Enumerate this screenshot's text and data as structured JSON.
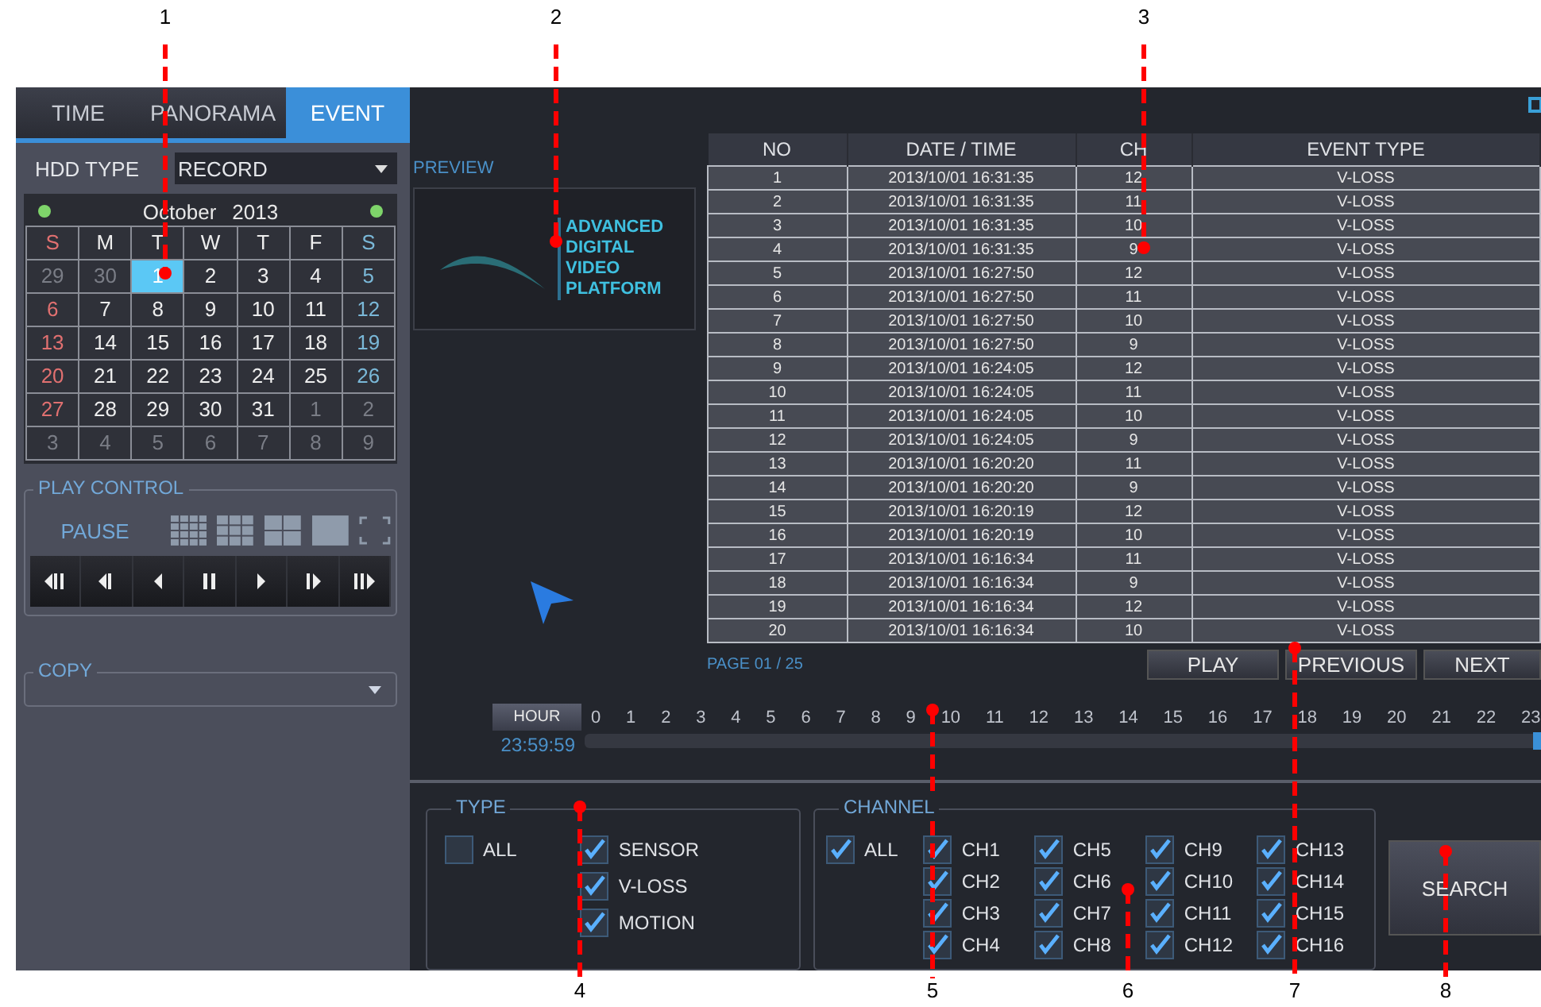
{
  "callouts": [
    {
      "label": "1"
    },
    {
      "label": "2"
    },
    {
      "label": "3"
    },
    {
      "label": "4"
    },
    {
      "label": "5"
    },
    {
      "label": "6"
    },
    {
      "label": "7"
    },
    {
      "label": "8"
    }
  ],
  "tabs": [
    {
      "label": "TIME",
      "selected": false
    },
    {
      "label": "PANORAMA",
      "selected": false
    },
    {
      "label": "EVENT",
      "selected": true
    }
  ],
  "hdd_type": {
    "label": "HDD TYPE",
    "value": "RECORD"
  },
  "calendar": {
    "month": "October",
    "year": "2013",
    "weekdays": [
      "S",
      "M",
      "T",
      "W",
      "T",
      "F",
      "S"
    ],
    "weeks": [
      [
        {
          "day": "29",
          "muted": true,
          "selected": false
        },
        {
          "day": "30",
          "muted": true,
          "selected": false
        },
        {
          "day": "1",
          "muted": false,
          "selected": true
        },
        {
          "day": "2",
          "muted": false,
          "selected": false
        },
        {
          "day": "3",
          "muted": false,
          "selected": false
        },
        {
          "day": "4",
          "muted": false,
          "selected": false
        },
        {
          "day": "5",
          "muted": false,
          "selected": false
        }
      ],
      [
        {
          "day": "6",
          "muted": false,
          "selected": false
        },
        {
          "day": "7",
          "muted": false,
          "selected": false
        },
        {
          "day": "8",
          "muted": false,
          "selected": false
        },
        {
          "day": "9",
          "muted": false,
          "selected": false
        },
        {
          "day": "10",
          "muted": false,
          "selected": false
        },
        {
          "day": "11",
          "muted": false,
          "selected": false
        },
        {
          "day": "12",
          "muted": false,
          "selected": false
        }
      ],
      [
        {
          "day": "13",
          "muted": false,
          "selected": false
        },
        {
          "day": "14",
          "muted": false,
          "selected": false
        },
        {
          "day": "15",
          "muted": false,
          "selected": false
        },
        {
          "day": "16",
          "muted": false,
          "selected": false
        },
        {
          "day": "17",
          "muted": false,
          "selected": false
        },
        {
          "day": "18",
          "muted": false,
          "selected": false
        },
        {
          "day": "19",
          "muted": false,
          "selected": false
        }
      ],
      [
        {
          "day": "20",
          "muted": false,
          "selected": false
        },
        {
          "day": "21",
          "muted": false,
          "selected": false
        },
        {
          "day": "22",
          "muted": false,
          "selected": false
        },
        {
          "day": "23",
          "muted": false,
          "selected": false
        },
        {
          "day": "24",
          "muted": false,
          "selected": false
        },
        {
          "day": "25",
          "muted": false,
          "selected": false
        },
        {
          "day": "26",
          "muted": false,
          "selected": false
        }
      ],
      [
        {
          "day": "27",
          "muted": false,
          "selected": false
        },
        {
          "day": "28",
          "muted": false,
          "selected": false
        },
        {
          "day": "29",
          "muted": false,
          "selected": false
        },
        {
          "day": "30",
          "muted": false,
          "selected": false
        },
        {
          "day": "31",
          "muted": false,
          "selected": false
        },
        {
          "day": "1",
          "muted": true,
          "selected": false
        },
        {
          "day": "2",
          "muted": true,
          "selected": false
        }
      ],
      [
        {
          "day": "3",
          "muted": true,
          "selected": false
        },
        {
          "day": "4",
          "muted": true,
          "selected": false
        },
        {
          "day": "5",
          "muted": true,
          "selected": false
        },
        {
          "day": "6",
          "muted": true,
          "selected": false
        },
        {
          "day": "7",
          "muted": true,
          "selected": false
        },
        {
          "day": "8",
          "muted": true,
          "selected": false
        },
        {
          "day": "9",
          "muted": true,
          "selected": false
        }
      ]
    ]
  },
  "play_control": {
    "title": "PLAY CONTROL",
    "status": "PAUSE"
  },
  "copy": {
    "title": "COPY"
  },
  "preview": {
    "label": "PREVIEW",
    "logo_lines": [
      "ADVANCED",
      "DIGITAL",
      "VIDEO",
      "PLATFORM"
    ]
  },
  "table": {
    "columns": [
      "NO",
      "DATE / TIME",
      "CH",
      "EVENT TYPE"
    ],
    "rows": [
      [
        "1",
        "2013/10/01 16:31:35",
        "12",
        "V-LOSS"
      ],
      [
        "2",
        "2013/10/01 16:31:35",
        "11",
        "V-LOSS"
      ],
      [
        "3",
        "2013/10/01 16:31:35",
        "10",
        "V-LOSS"
      ],
      [
        "4",
        "2013/10/01 16:31:35",
        "9",
        "V-LOSS"
      ],
      [
        "5",
        "2013/10/01 16:27:50",
        "12",
        "V-LOSS"
      ],
      [
        "6",
        "2013/10/01 16:27:50",
        "11",
        "V-LOSS"
      ],
      [
        "7",
        "2013/10/01 16:27:50",
        "10",
        "V-LOSS"
      ],
      [
        "8",
        "2013/10/01 16:27:50",
        "9",
        "V-LOSS"
      ],
      [
        "9",
        "2013/10/01 16:24:05",
        "12",
        "V-LOSS"
      ],
      [
        "10",
        "2013/10/01 16:24:05",
        "11",
        "V-LOSS"
      ],
      [
        "11",
        "2013/10/01 16:24:05",
        "10",
        "V-LOSS"
      ],
      [
        "12",
        "2013/10/01 16:24:05",
        "9",
        "V-LOSS"
      ],
      [
        "13",
        "2013/10/01 16:20:20",
        "11",
        "V-LOSS"
      ],
      [
        "14",
        "2013/10/01 16:20:20",
        "9",
        "V-LOSS"
      ],
      [
        "15",
        "2013/10/01 16:20:19",
        "12",
        "V-LOSS"
      ],
      [
        "16",
        "2013/10/01 16:20:19",
        "10",
        "V-LOSS"
      ],
      [
        "17",
        "2013/10/01 16:16:34",
        "11",
        "V-LOSS"
      ],
      [
        "18",
        "2013/10/01 16:16:34",
        "9",
        "V-LOSS"
      ],
      [
        "19",
        "2013/10/01 16:16:34",
        "12",
        "V-LOSS"
      ],
      [
        "20",
        "2013/10/01 16:16:34",
        "10",
        "V-LOSS"
      ]
    ]
  },
  "page": "PAGE 01 / 25",
  "buttons": [
    "PLAY",
    "PREVIOUS",
    "NEXT"
  ],
  "timeline": {
    "button": "HOUR",
    "hours": [
      "0",
      "1",
      "2",
      "3",
      "4",
      "5",
      "6",
      "7",
      "8",
      "9",
      "10",
      "11",
      "12",
      "13",
      "14",
      "15",
      "16",
      "17",
      "18",
      "19",
      "20",
      "21",
      "22",
      "23"
    ],
    "time": "23:59:59",
    "level": 1
  },
  "type_filter": {
    "title": "TYPE",
    "all": {
      "label": "ALL",
      "checked": false
    },
    "options": [
      {
        "label": "SENSOR",
        "checked": true
      },
      {
        "label": "V-LOSS",
        "checked": true
      },
      {
        "label": "MOTION",
        "checked": true
      }
    ]
  },
  "channel_filter": {
    "title": "CHANNEL",
    "all": {
      "label": "ALL",
      "checked": true
    },
    "channels": [
      {
        "label": "CH1",
        "checked": true
      },
      {
        "label": "CH2",
        "checked": true
      },
      {
        "label": "CH3",
        "checked": true
      },
      {
        "label": "CH4",
        "checked": true
      },
      {
        "label": "CH5",
        "checked": true
      },
      {
        "label": "CH6",
        "checked": true
      },
      {
        "label": "CH7",
        "checked": true
      },
      {
        "label": "CH8",
        "checked": true
      },
      {
        "label": "CH9",
        "checked": true
      },
      {
        "label": "CH10",
        "checked": true
      },
      {
        "label": "CH11",
        "checked": true
      },
      {
        "label": "CH12",
        "checked": true
      },
      {
        "label": "CH13",
        "checked": true
      },
      {
        "label": "CH14",
        "checked": true
      },
      {
        "label": "CH15",
        "checked": true
      },
      {
        "label": "CH16",
        "checked": true
      }
    ]
  },
  "search_button": "SEARCH"
}
